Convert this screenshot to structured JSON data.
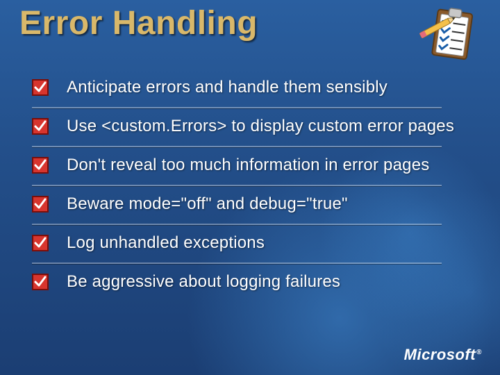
{
  "title": "Error Handling",
  "bullets": [
    "Anticipate errors and handle them sensibly",
    "Use <custom.Errors> to display custom error pages",
    "Don't reveal too much information in error pages",
    "Beware mode=\"off\" and debug=\"true\"",
    "Log unhandled exceptions",
    "Be aggressive about logging failures"
  ],
  "footer": {
    "brand": "Microsoft"
  }
}
